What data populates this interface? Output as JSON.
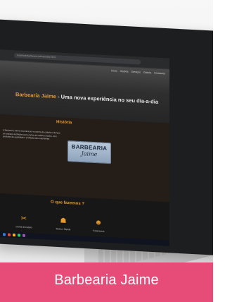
{
  "browser": {
    "url": "localhost/barbearia-jaime/index.html"
  },
  "nav": {
    "items": [
      "Início",
      "História",
      "Serviços",
      "Galeria",
      "Contactos"
    ]
  },
  "hero": {
    "brand": "Barbearia Jaime",
    "tagline": " - Uma nova experiência no seu dia-a-dia"
  },
  "history": {
    "title": "História",
    "text": "A Barbearia Jaime encontra-se no centro da cidade e oferece um espaço acolhedor para cortes de cabelo e barba, com produtos de qualidade e profissionais experientes.",
    "logo_line1": "BARBEARIA",
    "logo_line2": "Jaime"
  },
  "services": {
    "title": "O que fazemos ?",
    "items": [
      {
        "label": "Cortes de Cabelo",
        "icon": "scissors-icon"
      },
      {
        "label": "Barba e Bigode",
        "icon": "beard-icon"
      },
      {
        "label": "Tratamentos",
        "icon": "face-icon"
      }
    ]
  },
  "footer": {
    "label": "Barbearia Jaime"
  },
  "colors": {
    "accent": "#e89a2c",
    "banner": "#e64c77",
    "screen_bg": "#1a1a1a"
  }
}
